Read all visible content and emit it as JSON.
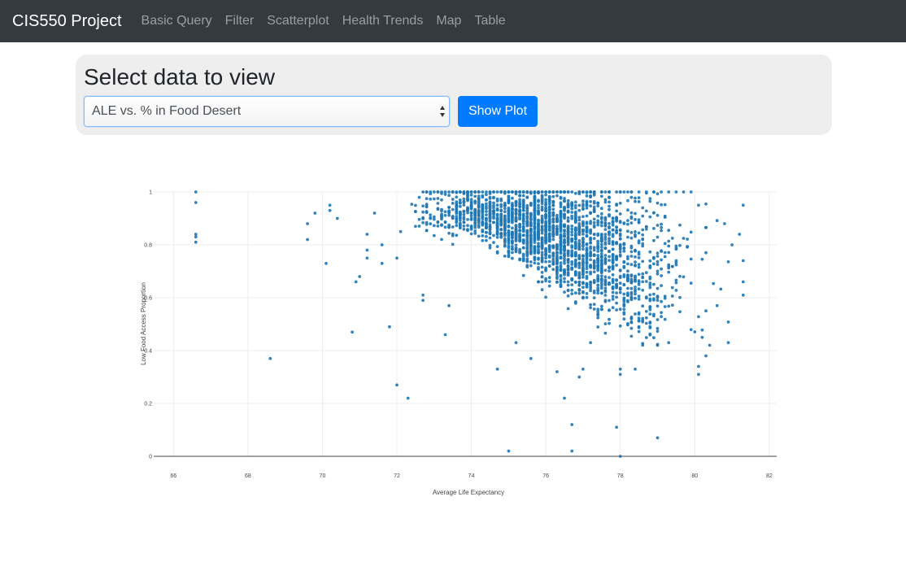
{
  "navbar": {
    "brand": "CIS550 Project",
    "links": [
      "Basic Query",
      "Filter",
      "Scatterplot",
      "Health Trends",
      "Map",
      "Table"
    ]
  },
  "panel": {
    "title": "Select data to view",
    "select_value": "ALE vs. % in Food Desert",
    "button_label": "Show Plot"
  },
  "colors": {
    "navbar_bg": "#343a40",
    "accent": "#007bff",
    "marker": "#1f77b4"
  },
  "chart_data": {
    "type": "scatter",
    "title": "",
    "xlabel": "Average Life Expectancy",
    "ylabel": "Low Food Access Proportion",
    "xlim": [
      65.6,
      82.2
    ],
    "ylim": [
      0,
      1
    ],
    "xticks": [
      "66",
      "68",
      "70",
      "72",
      "74",
      "76",
      "78",
      "80",
      "82"
    ],
    "yticks": [
      "0",
      "0.2",
      "0.4",
      "0.6",
      "0.8",
      "1"
    ],
    "grid": true,
    "series": [
      {
        "x": [
          66.6,
          66.6,
          66.6,
          66.6,
          68.6,
          69.6,
          69.6,
          69.8,
          70.1,
          70.2,
          70.2,
          70.4,
          70.8,
          70.9,
          71.0,
          71.2,
          71.2,
          71.2,
          71.4,
          71.6,
          71.6,
          71.8,
          72.0,
          72.0,
          72.1,
          72.3,
          72.7,
          72.7,
          73.3,
          73.4,
          74.7,
          75.0,
          75.2,
          75.6,
          76.3,
          76.5,
          76.7,
          76.7,
          76.9,
          77.0,
          77.2,
          77.9,
          78.0,
          78.0,
          78.0,
          78.4,
          79.0,
          79.3,
          80.1,
          80.1,
          80.3,
          80.9,
          80.2,
          81.3,
          81.3,
          81.3,
          81.0,
          80.6,
          81.2,
          80.8,
          66.6,
          81.3
        ],
        "y": [
          1.0,
          0.96,
          0.83,
          0.81,
          0.37,
          0.88,
          0.82,
          0.92,
          0.73,
          0.95,
          0.93,
          0.9,
          0.47,
          0.66,
          0.68,
          0.84,
          0.78,
          0.75,
          0.92,
          0.8,
          0.73,
          0.49,
          0.27,
          0.75,
          0.85,
          0.22,
          0.61,
          0.59,
          0.46,
          0.57,
          0.33,
          0.02,
          0.43,
          0.37,
          0.32,
          0.22,
          0.12,
          0.02,
          0.3,
          0.33,
          0.43,
          0.11,
          0.0,
          0.31,
          0.33,
          0.33,
          0.07,
          0.43,
          0.34,
          0.31,
          0.38,
          0.43,
          0.45,
          0.61,
          0.66,
          0.74,
          0.8,
          0.57,
          0.84,
          0.88,
          0.84,
          0.95
        ]
      },
      {
        "name": "",
        "x": [
          72.7,
          72.9,
          73.1,
          73.3,
          73.5,
          73.7,
          73.9,
          74.1,
          74.3,
          74.5,
          74.7,
          74.9,
          75.1,
          75.3,
          75.5,
          75.7,
          75.9,
          76.1,
          76.3,
          76.5,
          76.7,
          76.9,
          77.1,
          77.3,
          77.5,
          77.7,
          77.9,
          78.1,
          78.3,
          78.5,
          78.7,
          78.9,
          79.1,
          79.3,
          79.5,
          79.7,
          79.9
        ],
        "y": [
          1.0,
          1.0,
          1.0,
          1.0,
          1.0,
          1.0,
          1.0,
          1.0,
          1.0,
          1.0,
          1.0,
          1.0,
          1.0,
          1.0,
          1.0,
          1.0,
          1.0,
          1.0,
          1.0,
          1.0,
          1.0,
          1.0,
          1.0,
          1.0,
          1.0,
          1.0,
          1.0,
          1.0,
          1.0,
          1.0,
          1.0,
          1.0,
          1.0,
          1.0,
          1.0,
          1.0,
          1.0
        ]
      }
    ]
  }
}
